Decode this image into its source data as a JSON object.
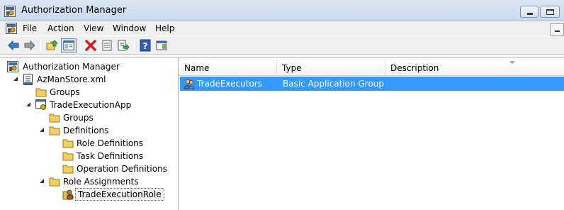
{
  "window": {
    "title": "Authorization Manager"
  },
  "menu": {
    "file": "File",
    "action": "Action",
    "view": "View",
    "window": "Window",
    "help": "Help"
  },
  "tree": {
    "root": "Authorization Manager",
    "store": "AzManStore.xml",
    "store_groups": "Groups",
    "app": "TradeExecutionApp",
    "app_groups": "Groups",
    "definitions": "Definitions",
    "role_definitions": "Role Definitions",
    "task_definitions": "Task Definitions",
    "operation_definitions": "Operation Definitions",
    "role_assignments": "Role Assignments",
    "role": "TradeExecutionRole"
  },
  "list": {
    "columns": [
      "Name",
      "Type",
      "Description"
    ],
    "rows": [
      {
        "name": "TradeExecutors",
        "type": "Basic Application Group",
        "description": ""
      }
    ]
  },
  "colors": {
    "selection": "#3399ff",
    "folder": "#f2cf5e",
    "titlebar": "#c9d9ec"
  }
}
